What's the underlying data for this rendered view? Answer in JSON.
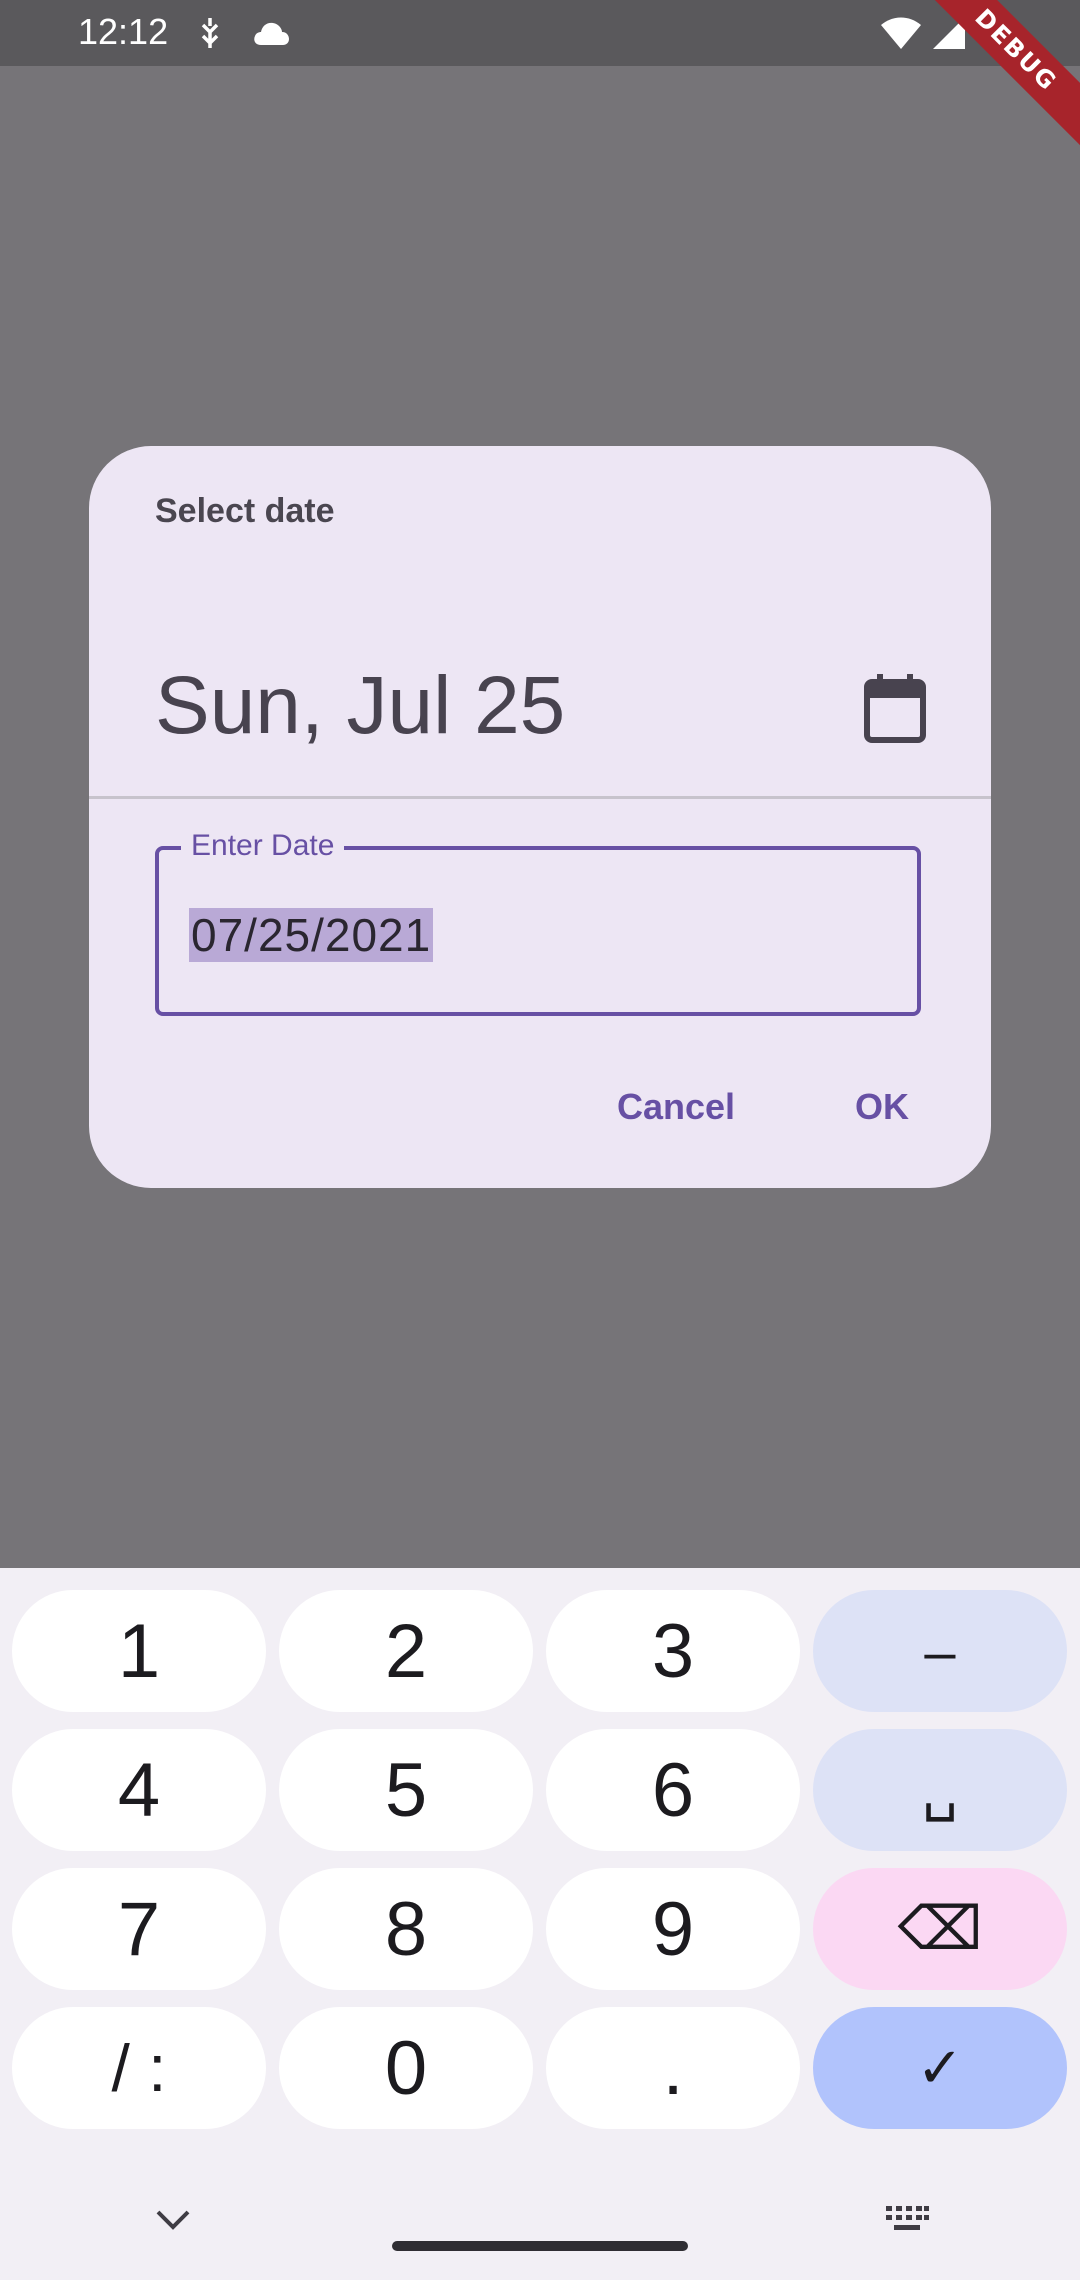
{
  "status_bar": {
    "time": "12:12",
    "icons": [
      "lightning-icon",
      "cloud-icon",
      "wifi-icon",
      "signal-icon"
    ]
  },
  "debug_banner": "DEBUG",
  "dialog": {
    "title": "Select date",
    "selected_date": "Sun, Jul 25",
    "calendar_icon": "calendar-icon",
    "field_label": "Enter Date",
    "field_value": "07/25/2021",
    "cancel_label": "Cancel",
    "ok_label": "OK"
  },
  "keyboard": {
    "keys": [
      "1",
      "2",
      "3",
      "–",
      "4",
      "5",
      "6",
      "␣",
      "7",
      "8",
      "9",
      "⌫",
      "/ :",
      "0",
      ".",
      "✓"
    ],
    "nav_icons": [
      "chevron-down-icon",
      "keyboard-icon"
    ]
  },
  "colors": {
    "accent": "#6750a4",
    "dialog_bg": "#ede6f4",
    "scrim": "#767478",
    "keyboard_bg": "#f2eff5"
  }
}
